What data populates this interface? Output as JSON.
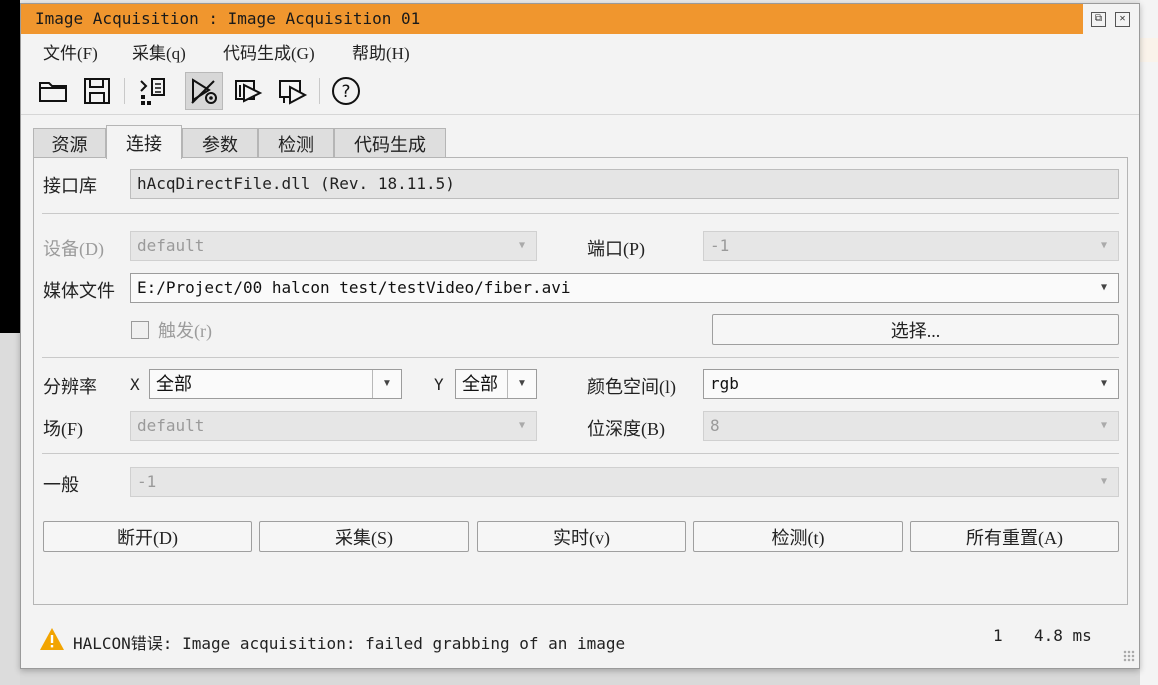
{
  "window": {
    "title": "Image Acquisition : Image Acquisition 01"
  },
  "menu": [
    "文件(F)",
    "采集(q)",
    "代码生成(G)",
    "帮助(H)"
  ],
  "toolbar_icons": [
    "open-folder-icon",
    "save-icon",
    "detect-devices-icon",
    "connect-icon",
    "insert-code-icon",
    "run-code-icon",
    "help-icon"
  ],
  "tabs": [
    "资源",
    "连接",
    "参数",
    "检测",
    "代码生成"
  ],
  "active_tab": "连接",
  "connection": {
    "interface_label": "接口库",
    "interface_value": "hAcqDirectFile.dll (Rev. 18.11.5)",
    "device_label": "设备(D)",
    "device_value": "default",
    "port_label": "端口(P)",
    "port_value": "-1",
    "media_label": "媒体文件",
    "media_value": "E:/Project/00 halcon test/testVideo/fiber.avi",
    "trigger_label": "触发(r)",
    "trigger_checked": false,
    "select_button": "选择...",
    "resolution_label": "分辨率",
    "x_label": "X",
    "x_value": "全部",
    "y_label": "Y",
    "y_value": "全部",
    "colorspace_label": "颜色空间(l)",
    "colorspace_value": "rgb",
    "field_label": "场(F)",
    "field_value": "default",
    "bitdepth_label": "位深度(B)",
    "bitdepth_value": "8",
    "general_label": "一般",
    "general_value": "-1"
  },
  "buttons": [
    "断开(D)",
    "采集(S)",
    "实时(v)",
    "检测(t)",
    "所有重置(A)"
  ],
  "status": {
    "message": "HALCON错误: Image acquisition: failed grabbing of an image",
    "count": "1",
    "time": "4.8 ms",
    "warning_color": "#f2a400"
  }
}
